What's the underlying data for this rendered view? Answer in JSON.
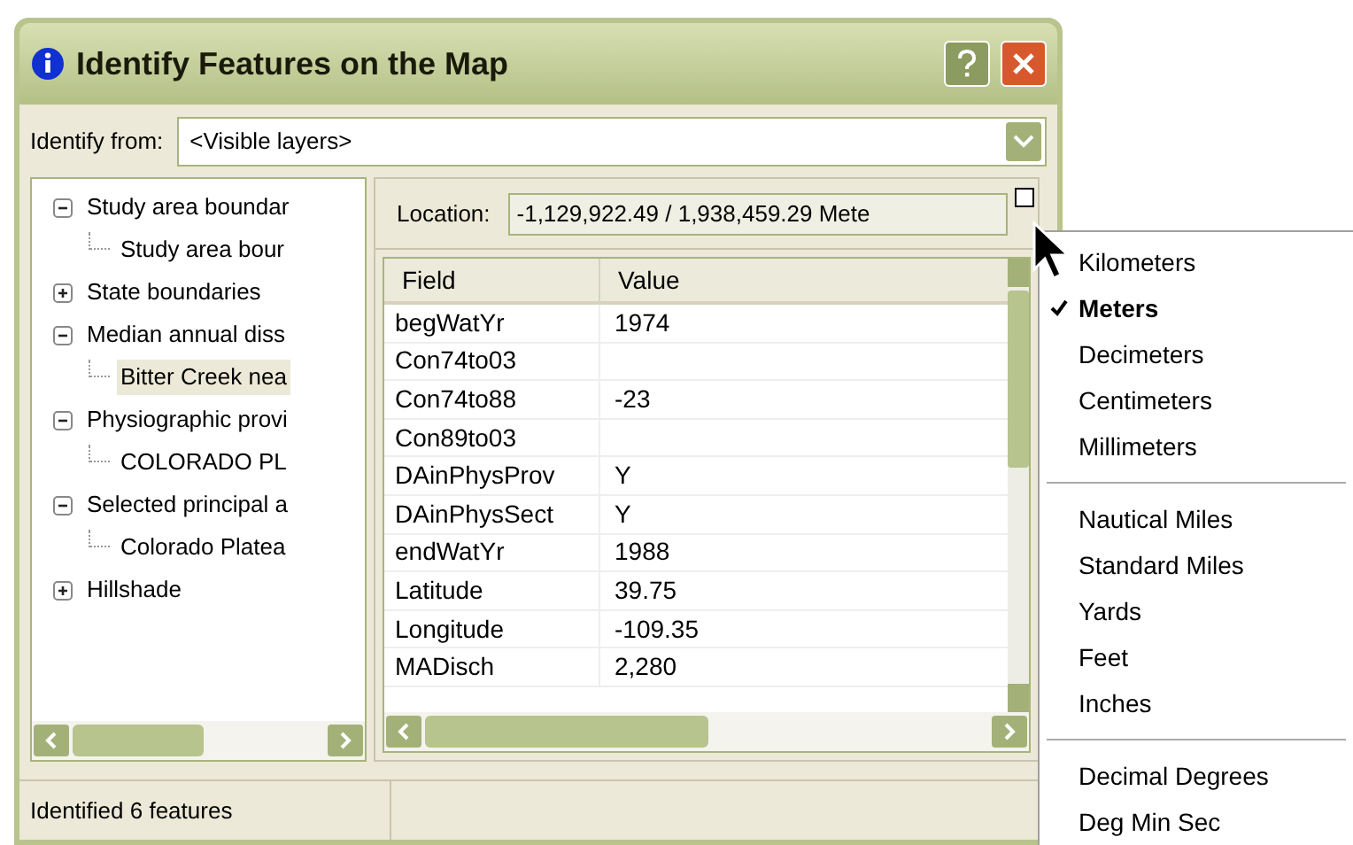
{
  "window": {
    "title": "Identify Features on the Map"
  },
  "identify_from": {
    "label": "Identify from:",
    "value": "<Visible layers>"
  },
  "tree": [
    {
      "label": "Study area boundar",
      "expanded": true,
      "selected": false,
      "children": [
        {
          "label": "Study area bour",
          "selected": false
        }
      ]
    },
    {
      "label": "State boundaries",
      "expanded": false,
      "selected": false
    },
    {
      "label": "Median annual diss",
      "expanded": true,
      "selected": false,
      "children": [
        {
          "label": "Bitter Creek nea",
          "selected": true
        }
      ]
    },
    {
      "label": "Physiographic provi",
      "expanded": true,
      "selected": false,
      "children": [
        {
          "label": "COLORADO PL",
          "selected": false
        }
      ]
    },
    {
      "label": "Selected principal a",
      "expanded": true,
      "selected": false,
      "children": [
        {
          "label": "Colorado Platea",
          "selected": false
        }
      ]
    },
    {
      "label": "Hillshade",
      "expanded": false,
      "selected": false
    }
  ],
  "location": {
    "label": "Location:",
    "value": "-1,129,922.49 / 1,938,459.29 Mete"
  },
  "table": {
    "columns": [
      "Field",
      "Value"
    ],
    "rows": [
      [
        "begWatYr",
        "1974"
      ],
      [
        "Con74to03",
        ""
      ],
      [
        "Con74to88",
        "-23"
      ],
      [
        "Con89to03",
        ""
      ],
      [
        "DAinPhysProv",
        "Y"
      ],
      [
        "DAinPhysSect",
        "Y"
      ],
      [
        "endWatYr",
        "1988"
      ],
      [
        "Latitude",
        "39.75"
      ],
      [
        "Longitude",
        "-109.35"
      ],
      [
        "MADisch",
        "2,280"
      ]
    ]
  },
  "status_bar": "Identified 6 features",
  "units_menu": [
    [
      {
        "label": "Kilometers",
        "checked": false
      },
      {
        "label": "Meters",
        "checked": true
      },
      {
        "label": "Decimeters",
        "checked": false
      },
      {
        "label": "Centimeters",
        "checked": false
      },
      {
        "label": "Millimeters",
        "checked": false
      }
    ],
    [
      {
        "label": "Nautical Miles",
        "checked": false
      },
      {
        "label": "Standard Miles",
        "checked": false
      },
      {
        "label": "Yards",
        "checked": false
      },
      {
        "label": "Feet",
        "checked": false
      },
      {
        "label": "Inches",
        "checked": false
      }
    ],
    [
      {
        "label": "Decimal Degrees",
        "checked": false
      },
      {
        "label": "Deg Min Sec",
        "checked": false
      }
    ]
  ]
}
